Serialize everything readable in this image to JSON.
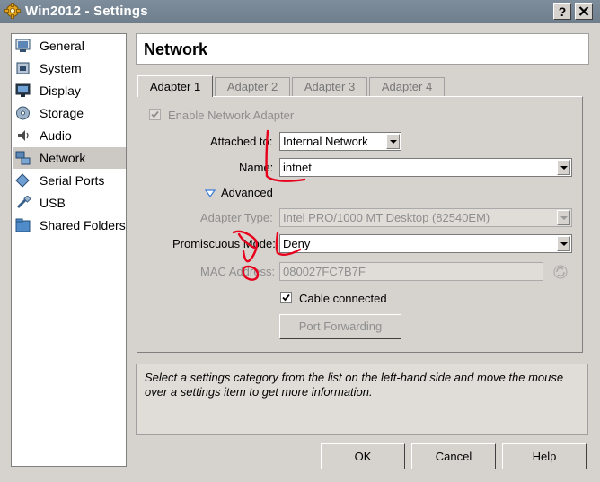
{
  "window": {
    "title": "Win2012 - Settings",
    "help_label": "?",
    "close_label": "X"
  },
  "sidebar": {
    "items": [
      {
        "label": "General",
        "icon": "general-icon"
      },
      {
        "label": "System",
        "icon": "system-icon"
      },
      {
        "label": "Display",
        "icon": "display-icon"
      },
      {
        "label": "Storage",
        "icon": "storage-icon"
      },
      {
        "label": "Audio",
        "icon": "audio-icon"
      },
      {
        "label": "Network",
        "icon": "network-icon",
        "selected": true
      },
      {
        "label": "Serial Ports",
        "icon": "serial-ports-icon"
      },
      {
        "label": "USB",
        "icon": "usb-icon"
      },
      {
        "label": "Shared Folders",
        "icon": "shared-folders-icon"
      }
    ]
  },
  "page": {
    "title": "Network"
  },
  "tabs": [
    {
      "label": "Adapter 1",
      "active": true
    },
    {
      "label": "Adapter 2"
    },
    {
      "label": "Adapter 3"
    },
    {
      "label": "Adapter 4"
    }
  ],
  "adapter": {
    "enable_label": "Enable Network Adapter",
    "enable_checked": true,
    "attached_label": "Attached to:",
    "attached_value": "Internal Network",
    "name_label": "Name:",
    "name_value": "intnet",
    "advanced_label": "Advanced",
    "adapter_type_label": "Adapter Type:",
    "adapter_type_value": "Intel PRO/1000 MT Desktop (82540EM)",
    "promiscuous_label": "Promiscuous Mode:",
    "promiscuous_value": "Deny",
    "mac_label": "MAC Address:",
    "mac_value": "080027FC7B7F",
    "cable_label": "Cable connected",
    "cable_checked": true,
    "port_forwarding_label": "Port Forwarding"
  },
  "info": {
    "text": "Select a settings category from the list on the left-hand side and move the mouse over a settings item to get more information."
  },
  "buttons": {
    "ok": "OK",
    "cancel": "Cancel",
    "help": "Help"
  },
  "colors": {
    "annotation": "#e8001c",
    "selection": "#ccc9c4",
    "title_bar": "#75848f"
  }
}
